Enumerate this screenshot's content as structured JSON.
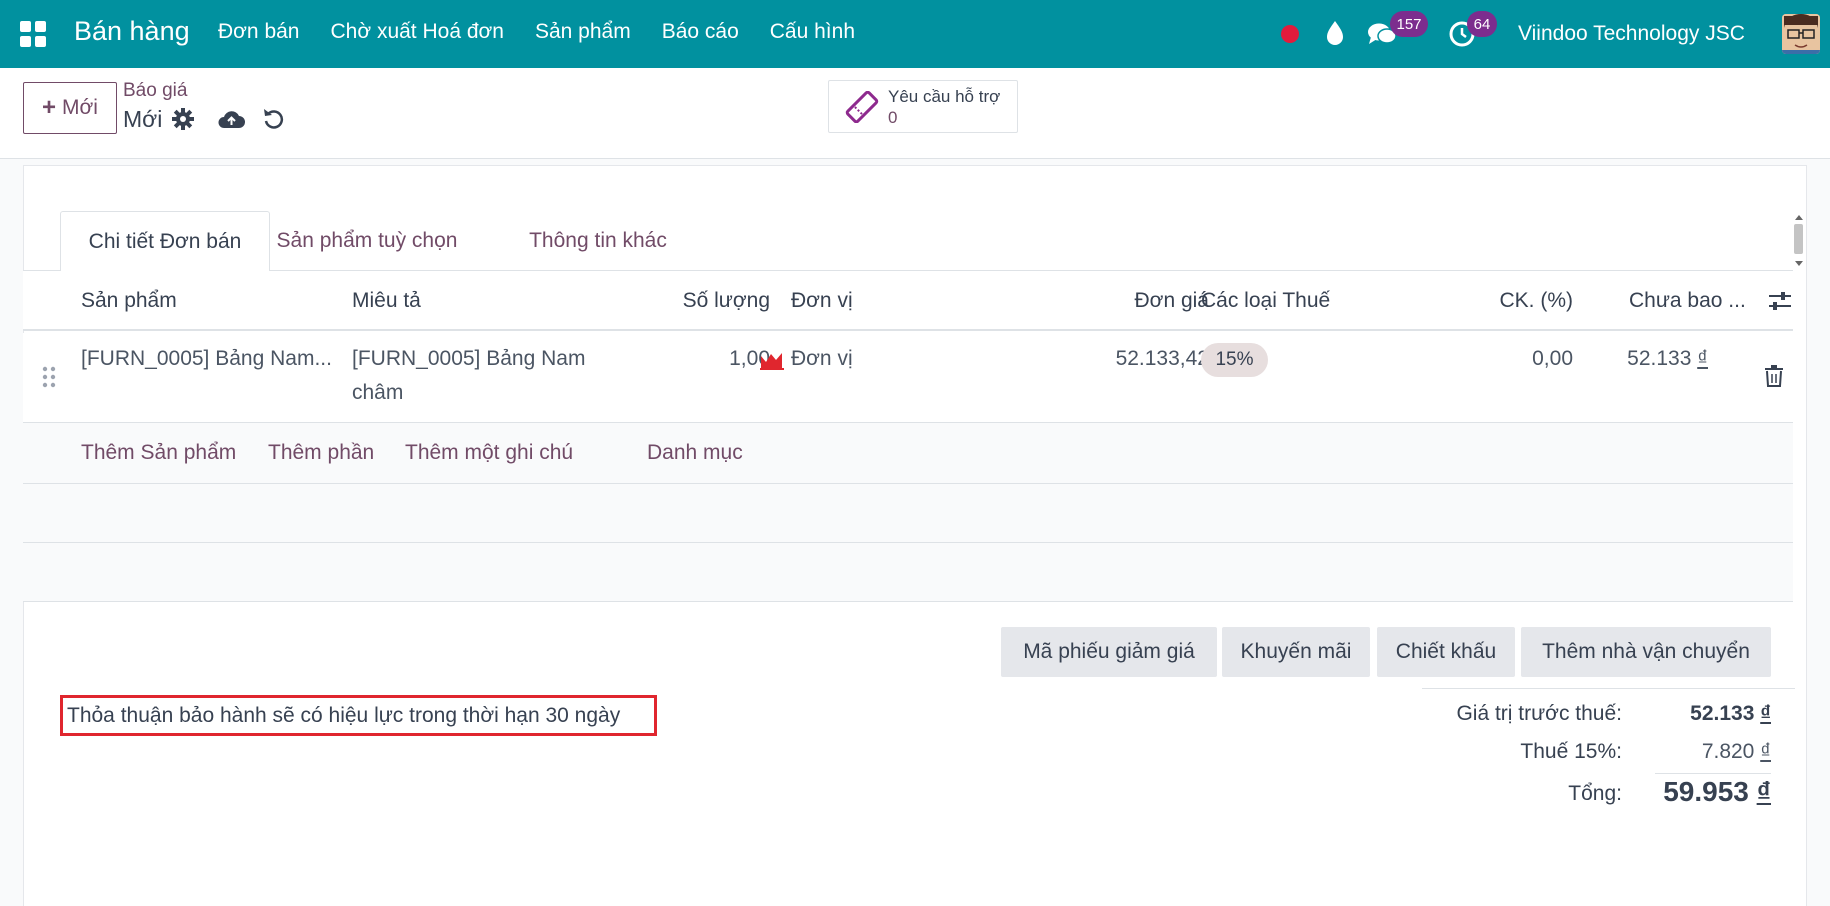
{
  "navbar": {
    "brand": "Bán hàng",
    "menu": [
      "Đơn bán",
      "Chờ xuất Hoá đơn",
      "Sản phẩm",
      "Báo cáo",
      "Cấu hình"
    ],
    "chat_count": "157",
    "activity_count": "64",
    "company": "Viindoo Technology JSC",
    "color": "#01919f"
  },
  "control": {
    "new_label": "Mới",
    "breadcrumb_parent": "Báo giá",
    "breadcrumb_current": "Mới",
    "support_label": "Yêu cầu hỗ trợ",
    "support_count": "0"
  },
  "tabs": [
    "Chi tiết Đơn bán",
    "Sản phẩm tuỳ chọn",
    "Thông tin khác"
  ],
  "table": {
    "headers": {
      "product": "Sản phẩm",
      "description": "Miêu tả",
      "quantity": "Số lượng",
      "uom": "Đơn vị",
      "unit_price": "Đơn giá",
      "taxes": "Các loại Thuế",
      "discount": "CK. (%)",
      "subtotal": "Chưa bao ..."
    },
    "rows": [
      {
        "product": "[FURN_0005] Bảng Nam...",
        "description_line1": "[FURN_0005] Bảng Nam",
        "description_line2": "châm",
        "quantity": "1,00",
        "uom": "Đơn vị",
        "unit_price": "52.133,42",
        "tax": "15%",
        "discount": "0,00",
        "subtotal": "52.133",
        "currency": "₫"
      }
    ],
    "add_links": [
      "Thêm Sản phẩm",
      "Thêm phần",
      "Thêm một ghi chú",
      "Danh mục"
    ]
  },
  "actions": [
    "Mã phiếu giảm giá",
    "Khuyến mãi",
    "Chiết khấu",
    "Thêm nhà vận chuyển"
  ],
  "note": "Thỏa thuận bảo hành sẽ có hiệu lực trong thời hạn 30 ngày",
  "totals": {
    "untaxed_label": "Giá trị trước thuế:",
    "untaxed_value": "52.133",
    "tax_label": "Thuế 15%:",
    "tax_value": "7.820",
    "total_label": "Tổng:",
    "total_value": "59.953",
    "currency": "₫"
  }
}
